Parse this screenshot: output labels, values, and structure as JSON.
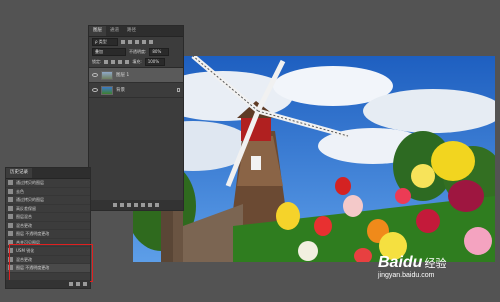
{
  "layers_panel": {
    "tabs": [
      "图层",
      "通道",
      "路径"
    ],
    "filter_label": "ρ 类型",
    "blend_mode": "叠加",
    "opacity_label": "不透明度:",
    "opacity_value": "80%",
    "lock_label": "锁定:",
    "fill_label": "填充:",
    "fill_value": "100%",
    "layers": [
      {
        "name": "图层 1",
        "selected": true
      },
      {
        "name": "背景",
        "selected": false
      }
    ]
  },
  "history_panel": {
    "title": "历史记录",
    "items": [
      {
        "label": "通过拷贝的图层",
        "selected": false
      },
      {
        "label": "去色",
        "selected": false
      },
      {
        "label": "通过拷贝的图层",
        "selected": false
      },
      {
        "label": "高反差保留",
        "selected": false
      },
      {
        "label": "图层混合",
        "selected": false
      },
      {
        "label": "混合更改",
        "selected": false
      },
      {
        "label": "图层 不透明度更改",
        "selected": false
      },
      {
        "label": "合并可见图层",
        "selected": false
      },
      {
        "label": "USM 锐化",
        "selected": false
      },
      {
        "label": "混合更改",
        "selected": false
      },
      {
        "label": "图层 不透明度更改",
        "selected": true
      }
    ]
  },
  "watermark": {
    "brand": "Baidu",
    "suffix": "经验",
    "url": "jingyan.baidu.com"
  }
}
